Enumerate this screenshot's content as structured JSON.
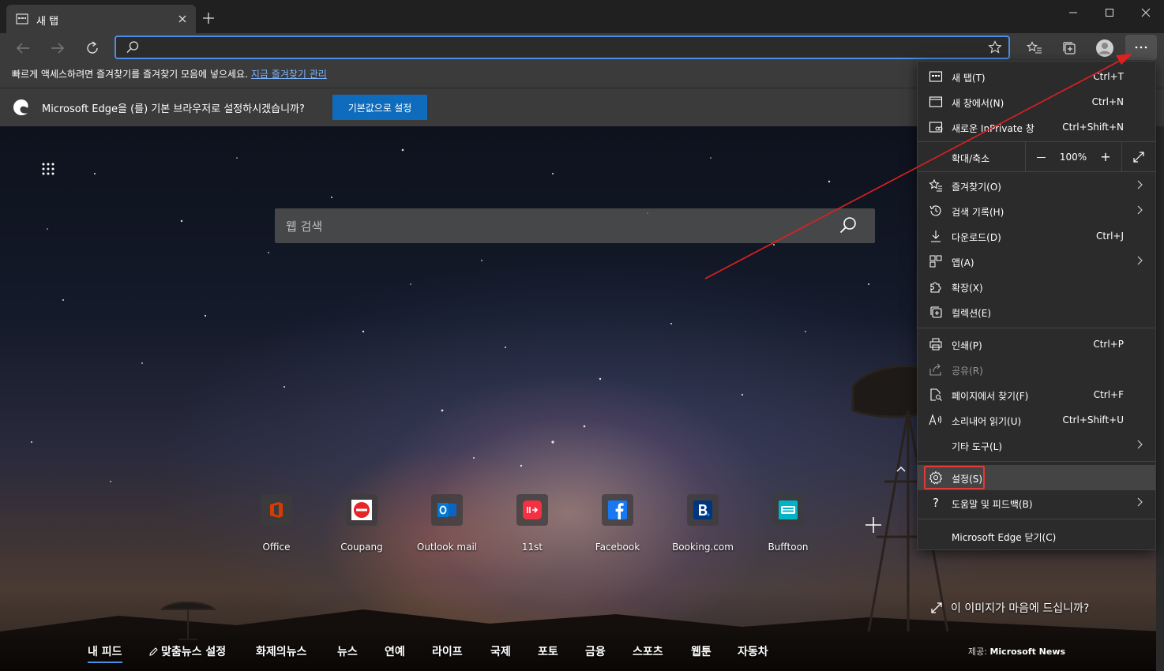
{
  "tab": {
    "title": "새 탭"
  },
  "favbar": {
    "text": "빠르게 액세스하려면 즐겨찾기를 즐겨찾기 모음에 넣으세요.",
    "link": "지금 즐겨찾기 관리"
  },
  "infobar": {
    "message": "Microsoft Edge을 (를) 기본 브라우저로 설정하시겠습니까?",
    "button": "기본값으로 설정"
  },
  "search": {
    "placeholder": "웹 검색"
  },
  "tiles": [
    {
      "label": "Office",
      "color": "#d83b01"
    },
    {
      "label": "Coupang",
      "color": "#e52528"
    },
    {
      "label": "Outlook mail",
      "color": "#0078d4"
    },
    {
      "label": "11st",
      "color": "#f43142"
    },
    {
      "label": "Facebook",
      "color": "#1877f2"
    },
    {
      "label": "Booking.com",
      "color": "#003580"
    },
    {
      "label": "Bufftoon",
      "color": "#00b3c7"
    }
  ],
  "like_image": "이 이미지가 마음에 드십니까?",
  "feed": {
    "items": [
      "내 피드",
      "맞춤뉴스 설정",
      "화제의뉴스",
      "뉴스",
      "연예",
      "라이프",
      "국제",
      "포토",
      "금융",
      "스포츠",
      "웹툰",
      "자동차"
    ],
    "provider_prefix": "제공:",
    "provider": "Microsoft News"
  },
  "menu": {
    "new_tab": {
      "label": "새 탭(T)",
      "shortcut": "Ctrl+T"
    },
    "new_window": {
      "label": "새 창에서(N)",
      "shortcut": "Ctrl+N"
    },
    "inprivate": {
      "label": "새로운 InPrivate 창",
      "shortcut": "Ctrl+Shift+N"
    },
    "zoom": {
      "label": "확대/축소",
      "minus": "—",
      "value": "100%",
      "plus": "+"
    },
    "favorites": {
      "label": "즐겨찾기(O)"
    },
    "history": {
      "label": "검색 기록(H)"
    },
    "downloads": {
      "label": "다운로드(D)",
      "shortcut": "Ctrl+J"
    },
    "apps": {
      "label": "앱(A)"
    },
    "extensions": {
      "label": "확장(X)"
    },
    "collections": {
      "label": "컬렉션(E)"
    },
    "print": {
      "label": "인쇄(P)",
      "shortcut": "Ctrl+P"
    },
    "share": {
      "label": "공유(R)"
    },
    "find": {
      "label": "페이지에서 찾기(F)",
      "shortcut": "Ctrl+F"
    },
    "read_aloud": {
      "label": "소리내어 읽기(U)",
      "shortcut": "Ctrl+Shift+U"
    },
    "more_tools": {
      "label": "기타 도구(L)"
    },
    "settings": {
      "label": "설정(S)"
    },
    "help": {
      "label": "도움말 및 피드백(B)"
    },
    "close": {
      "label": "Microsoft Edge 닫기(C)"
    }
  },
  "colors": {
    "accent": "#4a8fe7",
    "highlight": "#e53935",
    "button": "#0f6cbd"
  }
}
